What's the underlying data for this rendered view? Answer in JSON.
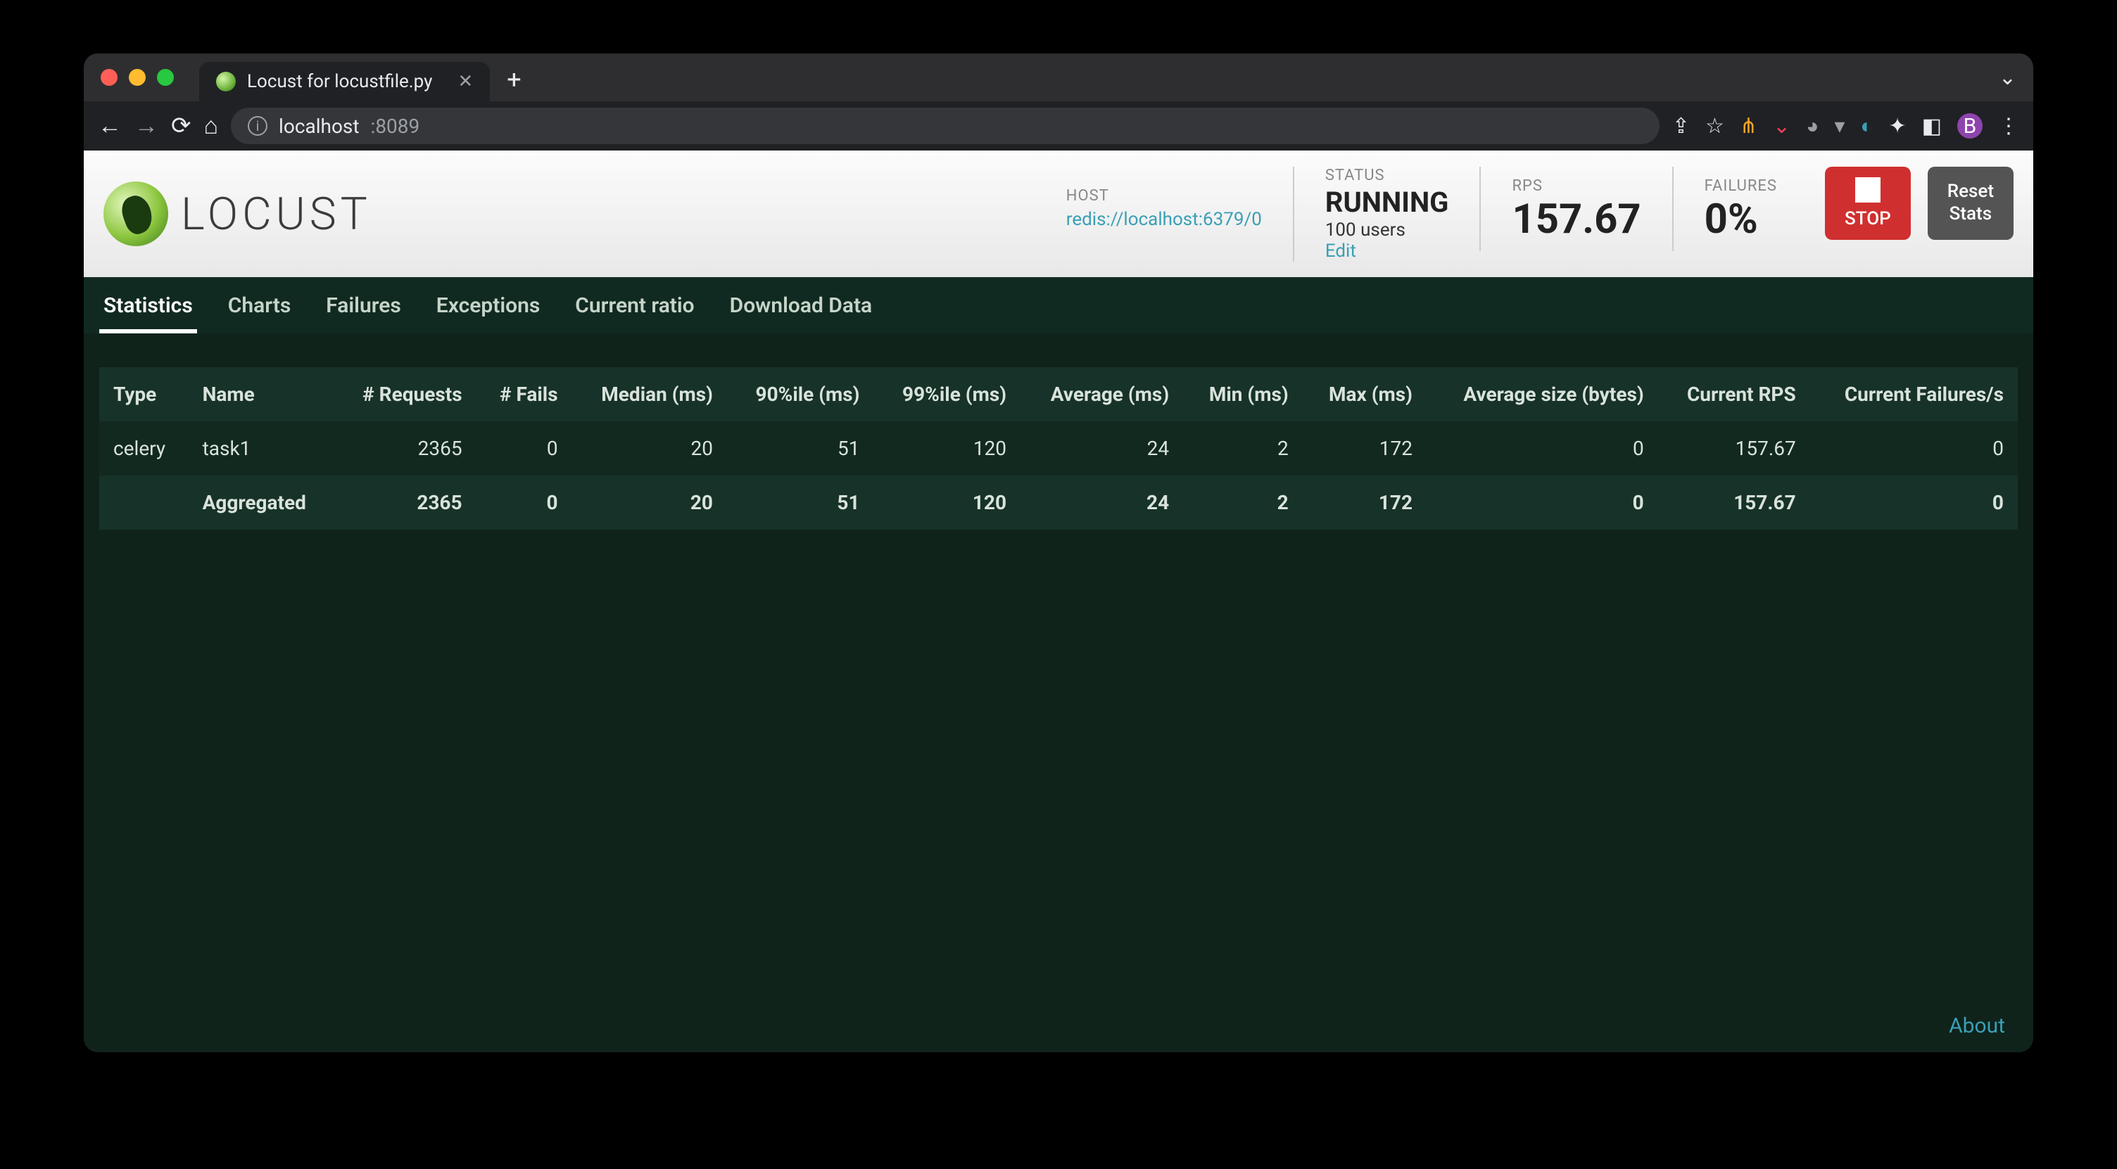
{
  "browser": {
    "tab_title": "Locust for locustfile.py",
    "url_host": "localhost",
    "url_port": ":8089"
  },
  "header": {
    "brand": "LOCUST",
    "host_label": "HOST",
    "host_value": "redis://localhost:6379/0",
    "status_label": "STATUS",
    "status_value": "RUNNING",
    "status_sub": "100 users",
    "status_edit": "Edit",
    "rps_label": "RPS",
    "rps_value": "157.67",
    "failures_label": "FAILURES",
    "failures_value": "0%",
    "stop_label": "STOP",
    "reset_line1": "Reset",
    "reset_line2": "Stats"
  },
  "tabs": {
    "statistics": "Statistics",
    "charts": "Charts",
    "failures": "Failures",
    "exceptions": "Exceptions",
    "current_ratio": "Current ratio",
    "download": "Download Data"
  },
  "table": {
    "cols": {
      "type": "Type",
      "name": "Name",
      "requests": "# Requests",
      "fails": "# Fails",
      "median": "Median (ms)",
      "p90": "90%ile (ms)",
      "p99": "99%ile (ms)",
      "avg": "Average (ms)",
      "min": "Min (ms)",
      "max": "Max (ms)",
      "avgsize": "Average size (bytes)",
      "cur_rps": "Current RPS",
      "cur_fail": "Current Failures/s"
    },
    "rows": [
      {
        "type": "celery",
        "name": "task1",
        "requests": "2365",
        "fails": "0",
        "median": "20",
        "p90": "51",
        "p99": "120",
        "avg": "24",
        "min": "2",
        "max": "172",
        "avgsize": "0",
        "cur_rps": "157.67",
        "cur_fail": "0"
      }
    ],
    "aggregated": {
      "type": "",
      "name": "Aggregated",
      "requests": "2365",
      "fails": "0",
      "median": "20",
      "p90": "51",
      "p99": "120",
      "avg": "24",
      "min": "2",
      "max": "172",
      "avgsize": "0",
      "cur_rps": "157.67",
      "cur_fail": "0"
    }
  },
  "footer": {
    "about": "About"
  }
}
